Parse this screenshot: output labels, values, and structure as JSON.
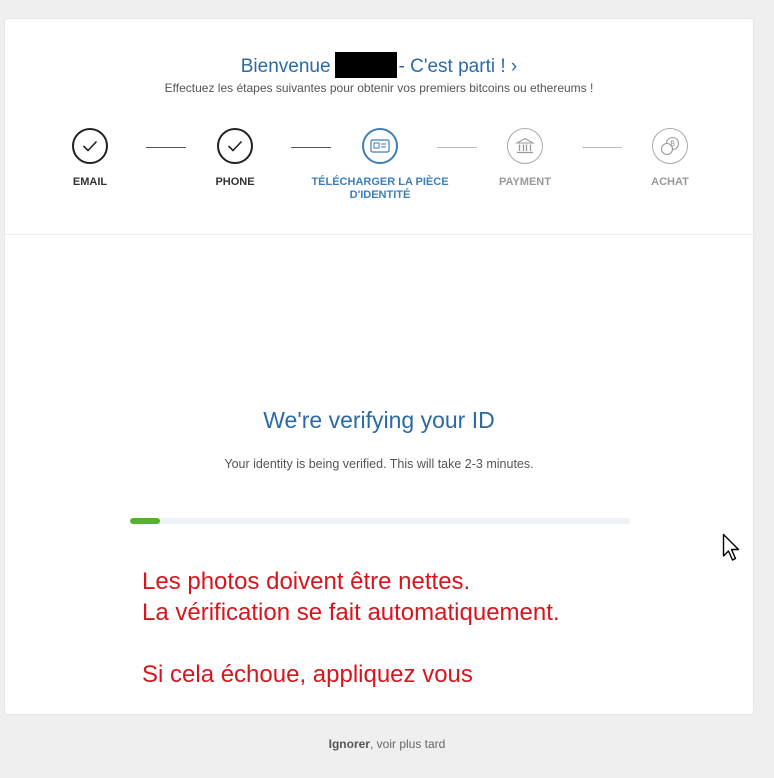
{
  "header": {
    "welcome_prefix": "Bienvenue",
    "welcome_link": "- C'est parti ! ›",
    "subtitle": "Effectuez les étapes suivantes pour obtenir vos premiers bitcoins ou ethereums !"
  },
  "steps": [
    {
      "label": "EMAIL",
      "status": "done",
      "icon": "check-icon"
    },
    {
      "label": "PHONE",
      "status": "done",
      "icon": "check-icon"
    },
    {
      "label": "TÉLÉCHARGER LA PIÈCE D'IDENTITÉ",
      "status": "active",
      "icon": "id-card-icon"
    },
    {
      "label": "PAYMENT",
      "status": "todo",
      "icon": "bank-icon"
    },
    {
      "label": "ACHAT",
      "status": "todo",
      "icon": "coins-icon"
    }
  ],
  "verify": {
    "title": "We're verifying your ID",
    "subtitle": "Your identity is being verified. This will take 2-3 minutes.",
    "progress_fraction": 0.06
  },
  "annotation": {
    "line1": "Les photos doivent être nettes.",
    "line2": "La vérification se fait automatiquement.",
    "line3": "Si cela échoue, appliquez vous"
  },
  "footer": {
    "ignore_label": "Ignorer",
    "later_text": ", voir plus tard"
  },
  "colors": {
    "accent": "#2a6aa6",
    "progress": "#55b32a",
    "annotation": "#d8151c"
  }
}
